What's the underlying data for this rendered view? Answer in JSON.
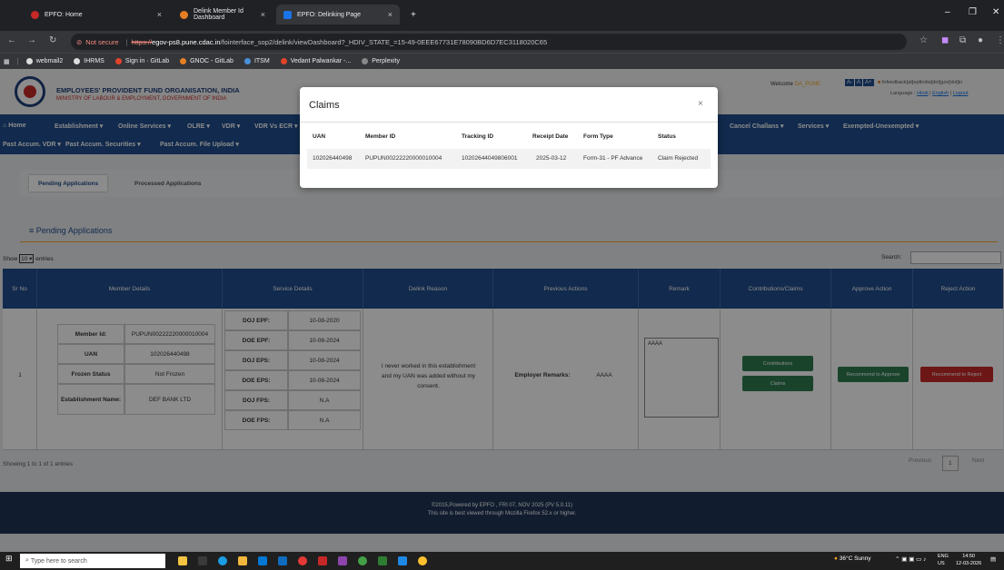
{
  "browser": {
    "tabs": [
      {
        "label": "EPFO: Home",
        "active": false
      },
      {
        "label": "Delink Member Id Dashboard",
        "active": false
      },
      {
        "label": "EPFO: Delinking Page",
        "active": true
      }
    ],
    "new_tab": "+",
    "not_secure": "Not secure",
    "url_scheme": "https://",
    "url_host": "egov-ps8.pune.cdac.in",
    "url_path": "/fointerface_sop2/delink/viewDashboard?_HDIV_STATE_=15-49-0EEE67731E78090BD6D7EC3118020C65",
    "bookmarks": [
      "webmail2",
      "IHRMS",
      "Sign in · GitLab",
      "GNOC - GitLab",
      "ITSM",
      "Vedant Palwankar -...",
      "Perplexity"
    ]
  },
  "header": {
    "org_name": "EMPLOYEES' PROVIDENT FUND ORGANISATION, INDIA",
    "ministry": "MINISTRY OF LABOUR & EMPLOYMENT, GOVERNMENT OF INDIA",
    "welcome_prefix": "Welcome",
    "welcome_user": "DA_PUNE",
    "font_sizes": [
      "A-",
      "A",
      "A+"
    ],
    "feedback": "fofeedback[at]epfindia[dot]gov[dot]in",
    "language_label": "Language :",
    "lang_hindi": "Hindi",
    "lang_english": "English",
    "logout": "Logout"
  },
  "menu": {
    "row1": [
      "Home",
      "Establishment ▾",
      "Online Services ▾",
      "OLRE ▾",
      "VDR ▾",
      "VDR Vs ECR ▾",
      "Cancel Challans ▾",
      "Services ▾",
      "Exempted-Unexempted ▾"
    ],
    "row2": [
      "Past Accum. VDR ▾",
      "Past Accum. Securities ▾",
      "Past Accum. File Upload ▾"
    ]
  },
  "subtabs": {
    "pending": "Pending Applications",
    "processed": "Processed Applications"
  },
  "section_title": "Pending Applications",
  "table_controls": {
    "show": "Show",
    "entries_value": "10",
    "entries": "entries",
    "search": "Search:"
  },
  "table": {
    "headers": [
      "Sr No",
      "Member Details",
      "Service Details",
      "Delink Reason",
      "Previous Actions",
      "Remark",
      "Contributions/Claims",
      "Approve Action",
      "Reject Action"
    ],
    "row": {
      "sr": "1",
      "member": [
        {
          "label": "Member Id:",
          "value": "PUPUN00222220000010004"
        },
        {
          "label": "UAN",
          "value": "102026440498"
        },
        {
          "label": "Frozen Status",
          "value": "Not Frozen"
        },
        {
          "label": "Establishment Name:",
          "value": "DEF BANK LTD"
        }
      ],
      "service": [
        {
          "label": "DOJ EPF:",
          "value": "10-08-2020"
        },
        {
          "label": "DOE EPF:",
          "value": "10-08-2024"
        },
        {
          "label": "DOJ EPS:",
          "value": "10-08-2024"
        },
        {
          "label": "DOE EPS:",
          "value": "10-08-2024"
        },
        {
          "label": "DOJ FPS:",
          "value": "N.A"
        },
        {
          "label": "DOE FPS:",
          "value": "N.A"
        }
      ],
      "reason": "I never worked in this establishment and my UAN was added without my consent.",
      "prev_label": "Employer Remarks:",
      "prev_value": "AAAA",
      "remark": "AAAA",
      "contributions_btn": "Contributions",
      "claims_btn": "Claims",
      "approve_btn": "Recommend to Approve",
      "reject_btn": "Recommend to Reject"
    }
  },
  "pagination": {
    "showing": "Showing 1 to 1 of 1 entries",
    "previous": "Previous",
    "current": "1",
    "next": "Next"
  },
  "footer": {
    "line1": "©2015,Powered by EPFO , FRI 07, NOV 2025 (PV 5.0.11)",
    "line2": "This site is best viewed through Mozilla Firefox 52.x or higher."
  },
  "modal": {
    "title": "Claims",
    "close": "×",
    "headers": [
      "UAN",
      "Member ID",
      "Tracking ID",
      "Receipt Date",
      "Form Type",
      "Status"
    ],
    "row": [
      "102026440498",
      "PUPUN00222220000010004",
      "10202644049806001",
      "2025-03-12",
      "Form-31 - PF Advance",
      "Claim Rejected"
    ]
  },
  "taskbar": {
    "search_placeholder": "Type here to search",
    "weather": "36°C  Sunny",
    "lang": "ENG",
    "region": "US",
    "time": "14:50",
    "date": "12-03-2026"
  },
  "colors": {
    "primary": "#1f4e8c",
    "approve": "#2e7d4f",
    "reject": "#c62828",
    "accent": "#f5a623"
  }
}
